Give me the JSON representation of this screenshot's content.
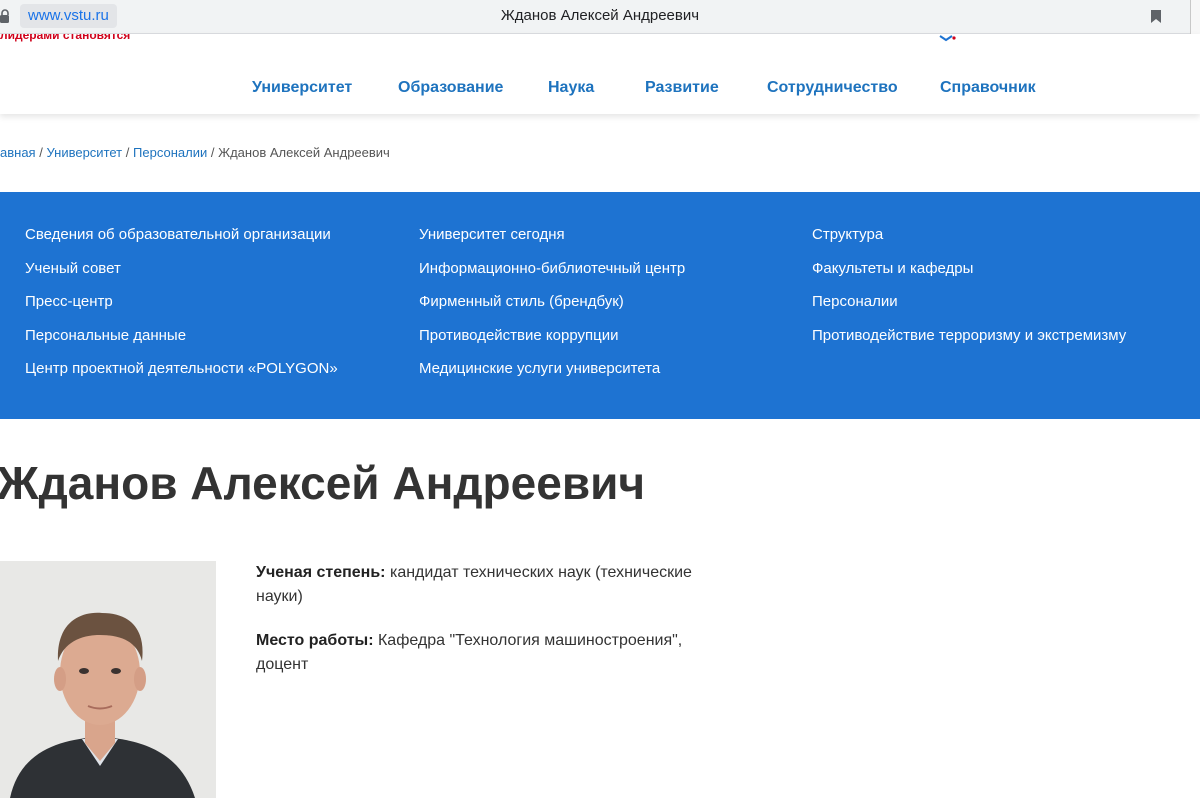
{
  "browser": {
    "url": "www.vstu.ru",
    "title": "Жданов Алексей Андреевич"
  },
  "header": {
    "slogan": "лидерами становятся"
  },
  "nav": {
    "items": [
      {
        "label": "Университет"
      },
      {
        "label": "Образование"
      },
      {
        "label": "Наука"
      },
      {
        "label": "Развитие"
      },
      {
        "label": "Сотрудничество"
      },
      {
        "label": "Справочник"
      }
    ]
  },
  "breadcrumb": {
    "items": [
      {
        "label": "авная"
      },
      {
        "label": "Университет"
      },
      {
        "label": "Персоналии"
      }
    ],
    "separator": "/",
    "current": "Жданов Алексей Андреевич"
  },
  "menu": {
    "columns": [
      {
        "links": [
          {
            "label": "Сведения об образовательной организации"
          },
          {
            "label": "Ученый совет"
          },
          {
            "label": "Пресс-центр"
          },
          {
            "label": "Персональные данные"
          },
          {
            "label": "Центр проектной деятельности «POLYGON»"
          }
        ]
      },
      {
        "links": [
          {
            "label": "Университет сегодня"
          },
          {
            "label": "Информационно-библиотечный центр"
          },
          {
            "label": "Фирменный стиль (брендбук)"
          },
          {
            "label": "Противодействие коррупции"
          },
          {
            "label": "Медицинские услуги университета"
          }
        ]
      },
      {
        "links": [
          {
            "label": "Структура"
          },
          {
            "label": "Факультеты и кафедры"
          },
          {
            "label": "Персоналии"
          },
          {
            "label": "Противодействие терроризму и экстремизму"
          }
        ]
      }
    ]
  },
  "person": {
    "name": "Жданов Алексей Андреевич",
    "degree_label": "Ученая степень:",
    "degree_value": "кандидат технических наук (технические науки)",
    "workplace_label": "Место работы:",
    "workplace_value": "Кафедра \"Технология машиностроения\", доцент"
  },
  "colors": {
    "brand_blue": "#1e73d2",
    "link_blue": "#1e73be",
    "slogan_red": "#d0021b"
  },
  "icons": {
    "lock": "lock-icon",
    "bookmark": "bookmark-icon",
    "photo": "person-photo"
  }
}
